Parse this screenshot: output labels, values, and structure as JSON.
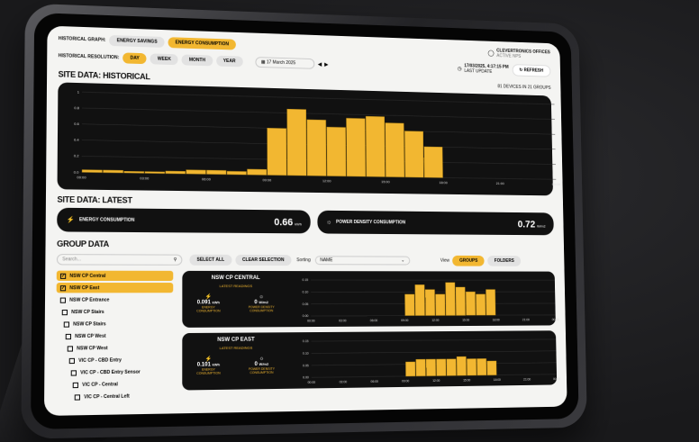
{
  "header": {
    "historical_graph_label": "HISTORICAL GRAPH:",
    "tabs": [
      {
        "label": "ENERGY SAVINGS",
        "active": false
      },
      {
        "label": "ENERGY CONSUMPTION",
        "active": true
      }
    ],
    "org_name": "CLEVERTRONICS OFFICES",
    "org_sub": "ACTIVE NPS",
    "resolution_label": "HISTORICAL RESOLUTION:",
    "resolutions": [
      {
        "label": "DAY",
        "active": true
      },
      {
        "label": "WEEK",
        "active": false
      },
      {
        "label": "MONTH",
        "active": false
      },
      {
        "label": "YEAR",
        "active": false
      }
    ],
    "date_value": "17 March 2025",
    "timestamp": "17/03/2025, 4:17:15 PM",
    "last_update_label": "Last update",
    "refresh_label": "REFRESH"
  },
  "historical": {
    "title": "SITE DATA: HISTORICAL",
    "devices_note": "81 devices in 21 groups"
  },
  "chart_data": [
    {
      "type": "bar",
      "title": "SITE DATA: HISTORICAL",
      "x_ticks": [
        "00:00",
        "03:00",
        "06:00",
        "09:00",
        "12:00",
        "15:00",
        "18:00",
        "21:00",
        "00:00"
      ],
      "y_ticks": [
        "0.0",
        "0.2",
        "0.4",
        "0.6",
        "0.8",
        "1"
      ],
      "ylim": [
        0,
        1
      ],
      "values": [
        0.03,
        0.03,
        0.02,
        0.02,
        0.03,
        0.05,
        0.05,
        0.04,
        0.07,
        0.6,
        0.85,
        0.72,
        0.63,
        0.75,
        0.78,
        0.7,
        0.6,
        0.4,
        0,
        0,
        0,
        0,
        0,
        0
      ]
    },
    {
      "type": "bar",
      "title": "NSW CP CENTRAL",
      "x_ticks": [
        "00:00",
        "03:00",
        "06:00",
        "09:00",
        "12:00",
        "15:00",
        "18:00",
        "21:00",
        "00:00"
      ],
      "y_ticks": [
        "0.00",
        "0.05",
        "0.10",
        "0.15"
      ],
      "ylim": [
        0,
        0.15
      ],
      "values": [
        0,
        0,
        0,
        0,
        0,
        0,
        0,
        0,
        0,
        0.09,
        0.13,
        0.11,
        0.09,
        0.14,
        0.12,
        0.1,
        0.09,
        0.11,
        0,
        0,
        0,
        0,
        0,
        0
      ]
    },
    {
      "type": "bar",
      "title": "NSW CP EAST",
      "x_ticks": [
        "00:00",
        "03:00",
        "06:00",
        "09:00",
        "12:00",
        "15:00",
        "18:00",
        "21:00",
        "00:00"
      ],
      "y_ticks": [
        "0.00",
        "0.05",
        "0.10",
        "0.15"
      ],
      "ylim": [
        0,
        0.15
      ],
      "values": [
        0,
        0,
        0,
        0,
        0,
        0,
        0,
        0,
        0,
        0.06,
        0.07,
        0.07,
        0.07,
        0.07,
        0.08,
        0.07,
        0.07,
        0.06,
        0,
        0,
        0,
        0,
        0,
        0
      ]
    }
  ],
  "latest": {
    "title": "SITE DATA: LATEST",
    "energy_label": "ENERGY CONSUMPTION",
    "energy_value": "0.66",
    "energy_unit": "kWh",
    "power_label": "POWER DENSITY CONSUMPTION",
    "power_value": "0.72",
    "power_unit": "W/m2"
  },
  "groups": {
    "title": "GROUP DATA",
    "search_placeholder": "Search...",
    "select_all": "SELECT ALL",
    "clear_selection": "CLEAR SELECTION",
    "sorting_label": "Sorting",
    "sorting_value": "NAME",
    "view_label": "View",
    "view_groups": "GROUPS",
    "view_folders": "FOLDERS",
    "items": [
      {
        "label": "NSW CP Central",
        "checked": true
      },
      {
        "label": "NSW CP East",
        "checked": true
      },
      {
        "label": "NSW CP Entrance",
        "checked": false
      },
      {
        "label": "NSW CP Stairs",
        "checked": false
      },
      {
        "label": "NSW CP Stairs",
        "checked": false
      },
      {
        "label": "NSW CP West",
        "checked": false
      },
      {
        "label": "NSW CP West",
        "checked": false
      },
      {
        "label": "VIC CP - CBD Entry",
        "checked": false
      },
      {
        "label": "VIC CP - CBD Entry Sensor",
        "checked": false
      },
      {
        "label": "VIC CP - Central",
        "checked": false
      },
      {
        "label": "VIC CP - Central Left",
        "checked": false
      }
    ],
    "cards": [
      {
        "title": "NSW CP CENTRAL",
        "latest": "LATEST READINGS",
        "energy": "0.091",
        "energy_unit": "kWh",
        "energy_label": "ENERGY CONSUMPTION",
        "power": "0",
        "power_unit": "W/m2",
        "power_label": "POWER DENSITY CONSUMPTION"
      },
      {
        "title": "NSW CP EAST",
        "latest": "LATEST READINGS",
        "energy": "0.101",
        "energy_unit": "kWh",
        "energy_label": "ENERGY CONSUMPTION",
        "power": "0",
        "power_unit": "W/m2",
        "power_label": "POWER DENSITY CONSUMPTION"
      }
    ]
  },
  "colors": {
    "accent": "#f2b731",
    "dark": "#111111",
    "background": "#f4f4f2"
  }
}
